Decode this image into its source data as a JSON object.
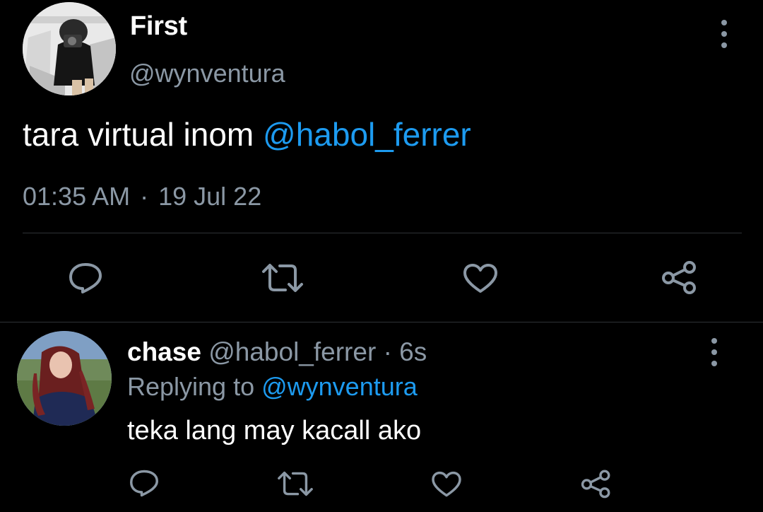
{
  "main_tweet": {
    "display_name": "First",
    "handle": "@wynventura",
    "text": "tara virtual inom ",
    "mention": "@habol_ferrer",
    "time": "01:35 AM",
    "separator": "·",
    "date": "19 Jul 22",
    "avatar_icon": "profile-photo",
    "actions": [
      "reply-icon",
      "retweet-icon",
      "like-icon",
      "share-icon"
    ]
  },
  "reply_tweet": {
    "display_name": "chase",
    "handle": "@habol_ferrer",
    "separator": "·",
    "time_ago": "6s",
    "replying_prefix": "Replying to ",
    "replying_to": "@wynventura",
    "text": "teka lang may kacall ako",
    "avatar_icon": "profile-photo",
    "actions": [
      "reply-icon",
      "retweet-icon",
      "like-icon",
      "share-icon"
    ]
  },
  "colors": {
    "background": "#000000",
    "primary_text": "#ffffff",
    "secondary_text": "#8b98a5",
    "accent": "#1d9bf0",
    "divider": "#2f3336"
  }
}
